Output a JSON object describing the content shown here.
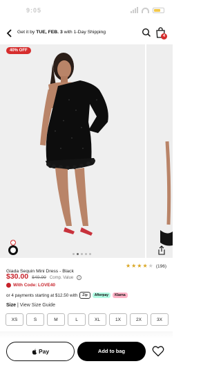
{
  "status_bar": {
    "time": "9:05"
  },
  "header": {
    "shipping_prefix": "Get it by ",
    "shipping_date": "TUE, FEB. 3",
    "shipping_suffix": " with 1-Day Shipping",
    "bag_count": "4"
  },
  "gallery": {
    "discount_badge": "40% OFF",
    "dots_total": 5,
    "dots_active": 1
  },
  "product": {
    "title": "Giada Sequin Mini Dress - Black",
    "rating_value": 3.5,
    "rating_count": "(196)",
    "price": "$30.00",
    "original_price": "$49.99",
    "comp_value_label": "Comp. Value",
    "promo_code_text": "With Code: LOVE40",
    "installments_text": "or 4 payments starting at $12.50 with",
    "pay_providers": [
      "Zip",
      "Afterpay",
      "Klarna"
    ]
  },
  "sizes": {
    "label": "Size",
    "guide_link": "View Size Guide",
    "options": [
      "XS",
      "S",
      "M",
      "L",
      "XL",
      "1X",
      "2X",
      "3X"
    ]
  },
  "actions": {
    "apple_pay_label": "Pay",
    "add_to_bag_label": "Add to bag"
  },
  "colors": {
    "accent": "#d62d2d",
    "price": "#c7222a",
    "button_dark": "#000000"
  }
}
